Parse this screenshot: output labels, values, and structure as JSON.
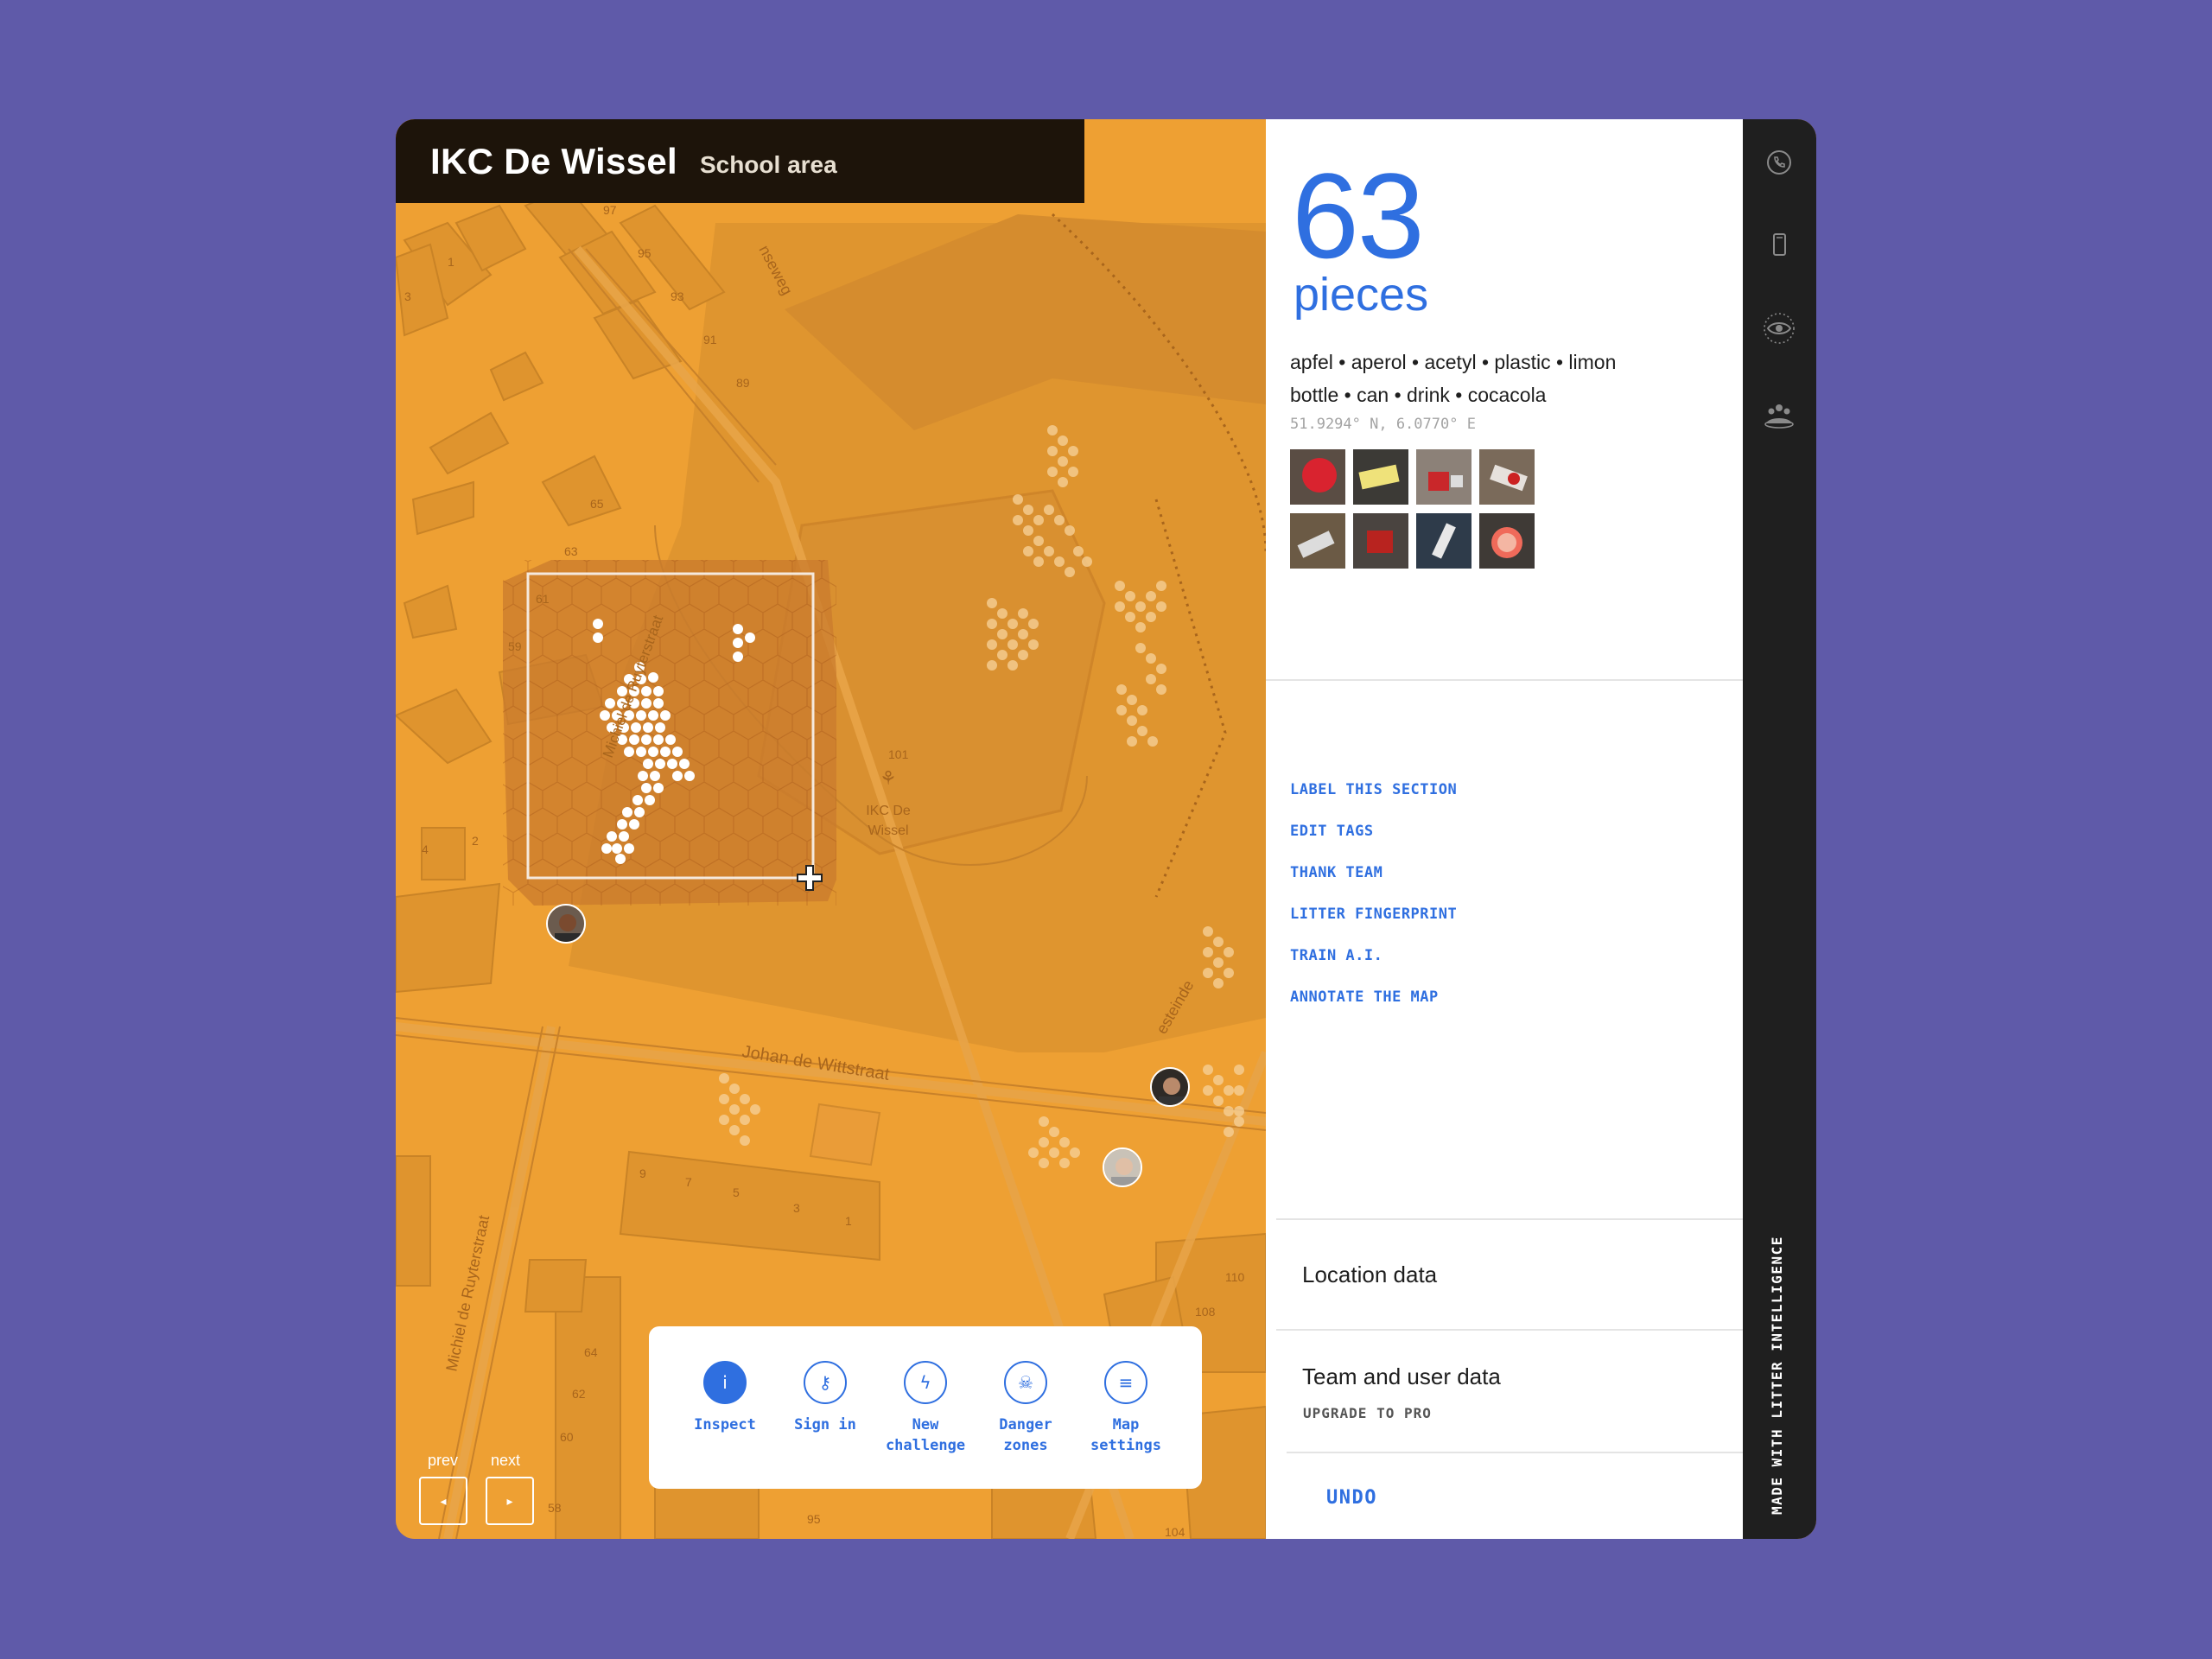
{
  "header": {
    "title": "IKC De Wissel",
    "subtitle": "School area"
  },
  "map": {
    "street_labels": [
      "Johan de Wittstraat",
      "Michiel de Ruyterstraat",
      "Michiel de Ruyterstraat",
      "...nseweg",
      "...esteinde"
    ],
    "school_label": "IKC De\nWissel",
    "house_numbers": [
      "97",
      "95",
      "93",
      "91",
      "89",
      "65",
      "63",
      "61",
      "59",
      "1",
      "3",
      "4",
      "2",
      "9",
      "7",
      "5",
      "3",
      "1",
      "64",
      "62",
      "60",
      "58",
      "95",
      "101",
      "110",
      "108",
      "104"
    ],
    "nav": {
      "prev_label": "prev",
      "next_label": "next",
      "prev_icon": "◂",
      "next_icon": "▸"
    }
  },
  "toolbar": {
    "tools": [
      {
        "label": "Inspect",
        "icon": "info-icon",
        "glyph": "i",
        "active": true
      },
      {
        "label": "Sign in",
        "icon": "key-icon",
        "glyph": "⚷",
        "active": false
      },
      {
        "label": "New\nchallenge",
        "icon": "lightning-icon",
        "glyph": "ϟ",
        "active": false
      },
      {
        "label": "Danger\nzones",
        "icon": "skull-icon",
        "glyph": "☠",
        "active": false
      },
      {
        "label": "Map\nsettings",
        "icon": "sliders-icon",
        "glyph": "≡",
        "active": false
      }
    ]
  },
  "panel": {
    "count": "63",
    "unit": "pieces",
    "tags_line1": "apfel • aperol • acetyl • plastic • limon",
    "tags_line2": "bottle • can • drink • cocacola",
    "coordinates": "51.9294° N, 6.0770° E",
    "actions": [
      "LABEL THIS SECTION",
      "EDIT TAGS",
      "THANK TEAM",
      "LITTER FINGERPRINT",
      "TRAIN A.I.",
      "ANNOTATE THE MAP"
    ],
    "location_data": "Location data",
    "team_data": "Team and user data",
    "upgrade": "UPGRADE TO PRO",
    "undo": "UNDO"
  },
  "rail": {
    "icons": [
      "phone-icon",
      "mobile-icon",
      "eye-icon",
      "team-icon"
    ],
    "vertical_text": "MADE WITH LITTER INTELLIGENCE"
  },
  "colors": {
    "accent": "#2f6fe0",
    "map": "#eea033",
    "rail": "#1f1f1f",
    "background": "#5f5aa9"
  }
}
